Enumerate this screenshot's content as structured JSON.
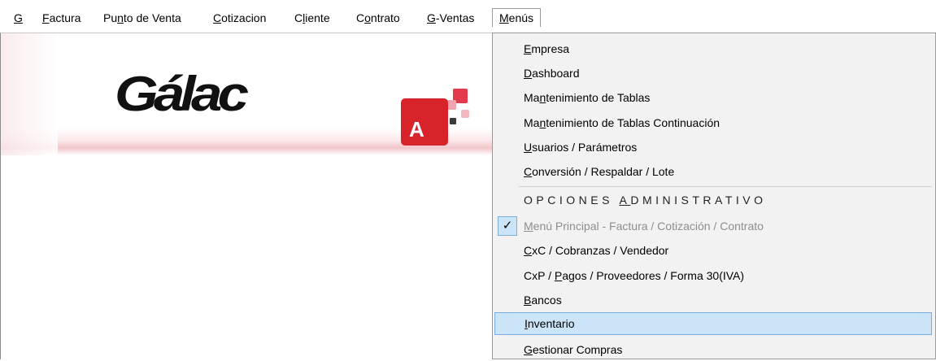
{
  "menubar": {
    "items": [
      {
        "pre": "",
        "key": "G",
        "post": ""
      },
      {
        "pre": "",
        "key": "F",
        "post": "actura"
      },
      {
        "pre": "Pu",
        "key": "n",
        "post": "to de Venta"
      },
      {
        "pre": "",
        "key": "C",
        "post": "otizacion"
      },
      {
        "pre": "C",
        "key": "l",
        "post": "iente"
      },
      {
        "pre": "C",
        "key": "o",
        "post": "ntrato"
      },
      {
        "pre": "",
        "key": "G",
        "post": "-Ventas"
      },
      {
        "pre": "",
        "key": "M",
        "post": "enús"
      }
    ]
  },
  "banner": {
    "logo_text": "Gálac",
    "app_icon_letter": "A"
  },
  "dropdown": {
    "items": [
      {
        "pre": "",
        "key": "E",
        "post": "mpresa"
      },
      {
        "pre": "",
        "key": "D",
        "post": "ashboard"
      },
      {
        "pre": "Ma",
        "key": "n",
        "post": "tenimiento de Tablas"
      },
      {
        "pre": "Ma",
        "key": "n",
        "post": "tenimiento de Tablas Continuación"
      },
      {
        "pre": "",
        "key": "U",
        "post": "suarios / Parámetros"
      },
      {
        "pre": "",
        "key": "C",
        "post": "onversión / Respaldar / Lote"
      },
      {
        "pre": "OPCIONES ",
        "key": "A",
        "post": "DMINISTRATIVO"
      },
      {
        "pre": "",
        "key": "M",
        "post": "enú Principal - Factura / Cotización / Contrato"
      },
      {
        "pre": "",
        "key": "C",
        "post": "xC / Cobranzas / Vendedor"
      },
      {
        "pre": "CxP / ",
        "key": "P",
        "post": "agos / Proveedores / Forma 30(IVA)"
      },
      {
        "pre": "",
        "key": "B",
        "post": "ancos"
      },
      {
        "pre": "",
        "key": "I",
        "post": "nventario"
      },
      {
        "pre": "",
        "key": "G",
        "post": "estionar Compras"
      }
    ],
    "checkmark": "✓"
  }
}
